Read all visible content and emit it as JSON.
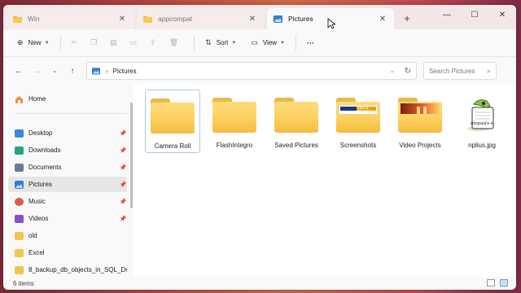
{
  "tabs": [
    {
      "title": "Win",
      "active": false
    },
    {
      "title": "appcompat",
      "active": false
    },
    {
      "title": "Pictures",
      "active": true
    }
  ],
  "toolbar": {
    "new_label": "New",
    "sort_label": "Sort",
    "view_label": "View",
    "more_label": "···"
  },
  "address": {
    "path": "Pictures",
    "search_placeholder": "Search Pictures"
  },
  "sidebar": {
    "items": [
      {
        "label": "Home",
        "icon": "home-icon",
        "pinned": false
      },
      {
        "label": "Desktop",
        "icon": "desktop-icon",
        "pinned": true
      },
      {
        "label": "Downloads",
        "icon": "downloads-icon",
        "pinned": true
      },
      {
        "label": "Documents",
        "icon": "documents-icon",
        "pinned": true
      },
      {
        "label": "Pictures",
        "icon": "pictures-icon",
        "pinned": true,
        "selected": true
      },
      {
        "label": "Music",
        "icon": "music-icon",
        "pinned": true
      },
      {
        "label": "Videos",
        "icon": "videos-icon",
        "pinned": true
      },
      {
        "label": "old",
        "icon": "folder-icon",
        "pinned": false
      },
      {
        "label": "Excel",
        "icon": "folder-icon",
        "pinned": false
      },
      {
        "label": "8_backup_db_objects_in_SQL_De",
        "icon": "folder-icon",
        "pinned": false
      }
    ]
  },
  "files": [
    {
      "name": "Camera Roll",
      "kind": "folder",
      "selected": true
    },
    {
      "name": "FlashIntegro",
      "kind": "folder"
    },
    {
      "name": "Saved Pictures",
      "kind": "folder"
    },
    {
      "name": "Screenshots",
      "kind": "folder-with-image",
      "thumb_text": "TIPS & TRICKS"
    },
    {
      "name": "Video Projects",
      "kind": "folder-with-image"
    },
    {
      "name": "nplius.jpg",
      "kind": "image",
      "thumb_text": "otepad++"
    }
  ],
  "status": {
    "item_count": "6 items"
  },
  "colors": {
    "accent": "#0067c0",
    "folder": "#f6c54d",
    "selection": "#e6e6e6"
  }
}
